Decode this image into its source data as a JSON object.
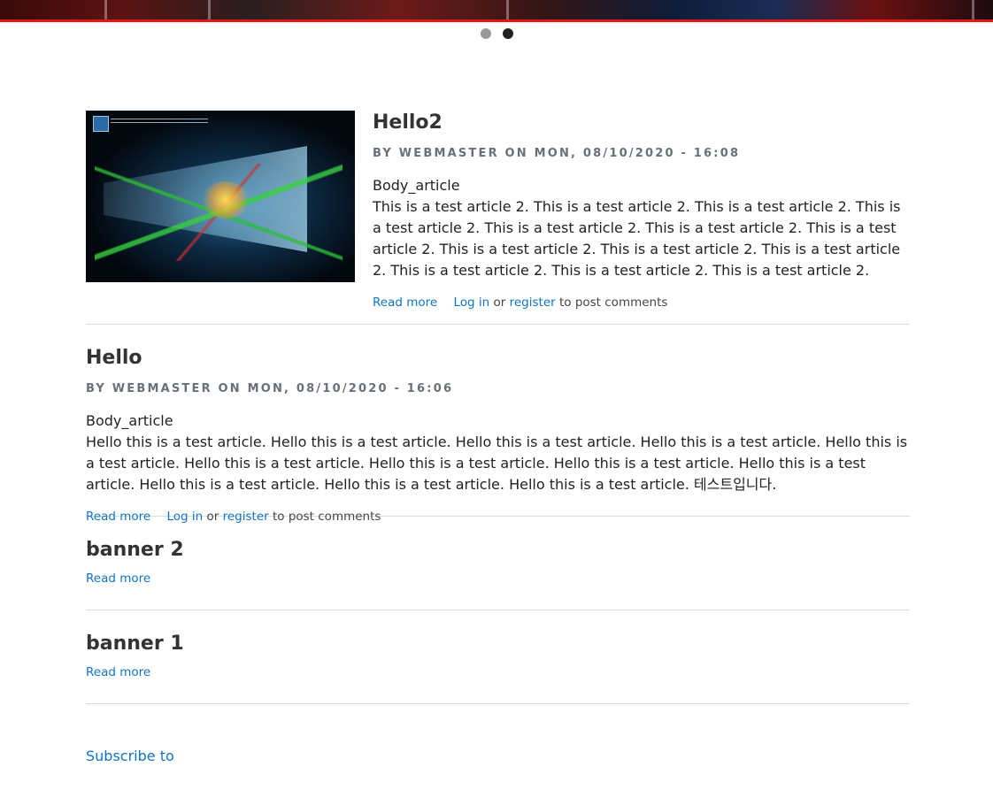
{
  "carousel": {
    "dots": [
      "slide-1",
      "slide-2"
    ],
    "active_index": 1
  },
  "articles": [
    {
      "title": "Hello2",
      "submitted": "BY WEBMASTER ON MON, 08/10/2020 - 16:08",
      "body_label": "Body_article",
      "body_text": "This is a test article 2. This is a test article 2. This is a test article 2. This is a test article 2. This is a test article 2. This is a test article 2. This is a test article 2. This is a test article 2. This is a test article 2. This is a test article 2. This is a test article 2. This is a test article 2. This is a test article 2.",
      "read_more": "Read more",
      "login": "Log in",
      "or": "or",
      "register": "register",
      "post_comments": "to post comments"
    },
    {
      "title": "Hello",
      "submitted": "BY WEBMASTER ON MON, 08/10/2020 - 16:06",
      "body_label": "Body_article",
      "body_text": "Hello this is a test article. Hello this is a test article. Hello this is a test article. Hello this is a test article. Hello this is a test article. Hello this is a test article. Hello this is a test article. Hello this is a test article. Hello this is a test article. Hello this is a test article. Hello this is a test article. Hello this is a test article. 테스트입니다.",
      "read_more": "Read more",
      "login": "Log in",
      "or": "or",
      "register": "register",
      "post_comments": "to post comments"
    },
    {
      "title": "banner 2",
      "read_more": "Read more"
    },
    {
      "title": "banner 1",
      "read_more": "Read more"
    }
  ],
  "subscribe": "Subscribe to",
  "colors": {
    "link": "#1174c8",
    "banner_border": "#e01818",
    "meta": "#68717a"
  }
}
